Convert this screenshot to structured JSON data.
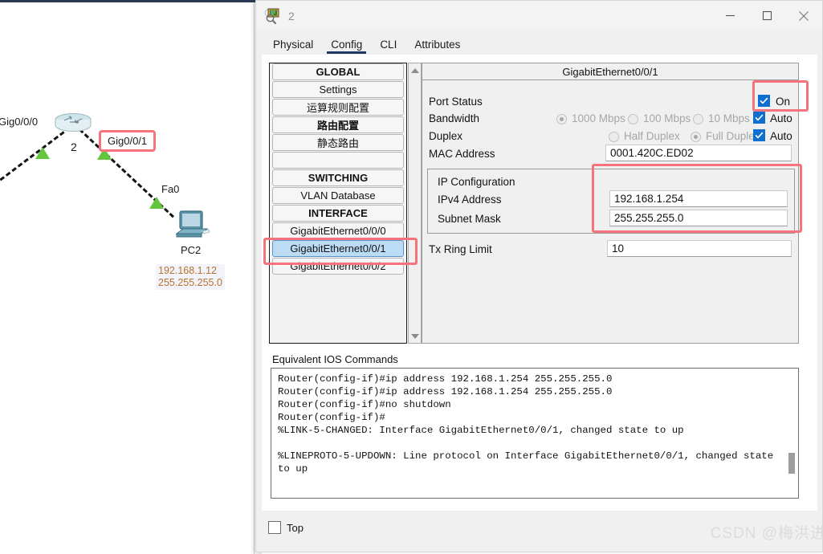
{
  "window": {
    "title": "2",
    "icon": "router-inspect-icon",
    "buttons": {
      "minimize": "—",
      "maximize": "□",
      "close": "✕"
    }
  },
  "tabs": [
    {
      "label": "Physical",
      "active": false
    },
    {
      "label": "Config",
      "active": true
    },
    {
      "label": "CLI",
      "active": false
    },
    {
      "label": "Attributes",
      "active": false
    }
  ],
  "sidebar": {
    "items": [
      {
        "label": "GLOBAL",
        "bold": true,
        "selected": false
      },
      {
        "label": "Settings",
        "bold": false,
        "selected": false
      },
      {
        "label": "运算规则配置",
        "bold": false,
        "selected": false
      },
      {
        "label": "路由配置",
        "bold": true,
        "selected": false
      },
      {
        "label": "静态路由",
        "bold": false,
        "selected": false
      },
      {
        "label": "",
        "bold": false,
        "selected": false
      },
      {
        "label": "SWITCHING",
        "bold": true,
        "selected": false
      },
      {
        "label": "VLAN Database",
        "bold": false,
        "selected": false
      },
      {
        "label": "INTERFACE",
        "bold": true,
        "selected": false
      },
      {
        "label": "GigabitEthernet0/0/0",
        "bold": false,
        "selected": false
      },
      {
        "label": "GigabitEthernet0/0/1",
        "bold": false,
        "selected": true
      },
      {
        "label": "GigabitEthernet0/0/2",
        "bold": false,
        "selected": false
      }
    ]
  },
  "port": {
    "header": "GigabitEthernet0/0/1",
    "port_status_label": "Port Status",
    "port_status_value": "On",
    "port_status_checked": true,
    "bandwidth_label": "Bandwidth",
    "bandwidth_options": [
      {
        "label": "1000 Mbps",
        "selected": true
      },
      {
        "label": "100 Mbps",
        "selected": false
      },
      {
        "label": "10 Mbps",
        "selected": false
      }
    ],
    "bandwidth_auto_label": "Auto",
    "bandwidth_auto_checked": true,
    "duplex_label": "Duplex",
    "duplex_options": [
      {
        "label": "Half Duplex",
        "selected": false
      },
      {
        "label": "Full Duplex",
        "selected": true
      }
    ],
    "duplex_auto_label": "Auto",
    "duplex_auto_checked": true,
    "mac_label": "MAC Address",
    "mac_value": "0001.420C.ED02",
    "ip_config_label": "IP Configuration",
    "ipv4_label": "IPv4 Address",
    "ipv4_value": "192.168.1.254",
    "subnet_label": "Subnet Mask",
    "subnet_value": "255.255.255.0",
    "tx_ring_label": "Tx Ring Limit",
    "tx_ring_value": "10"
  },
  "ios": {
    "label": "Equivalent IOS Commands",
    "text": "Router(config-if)#ip address 192.168.1.254 255.255.255.0\nRouter(config-if)#ip address 192.168.1.254 255.255.255.0\nRouter(config-if)#no shutdown\nRouter(config-if)#\n%LINK-5-CHANGED: Interface GigabitEthernet0/0/1, changed state to up\n\n%LINEPROTO-5-UPDOWN: Line protocol on Interface GigabitEthernet0/0/1, changed state to up"
  },
  "bottom": {
    "top_checkbox_label": "Top",
    "top_checkbox_checked": false
  },
  "topology": {
    "router_number": "2",
    "interface_left_label": "Gig0/0/0",
    "interface_right_label": "Gig0/0/1",
    "pc_interface_label": "Fa0",
    "pc_name": "PC2",
    "pc_ip": "192.168.1.12",
    "pc_mask": "255.255.255.0"
  },
  "watermark": "CSDN @梅洪进",
  "colors": {
    "accent_blue": "#0f6fd1",
    "highlight_red": "#f4737c",
    "tab_underline": "#1f3864",
    "selection_blue": "#bcdcf5",
    "link_green": "#63c63c",
    "ip_orange": "#b8742a"
  }
}
